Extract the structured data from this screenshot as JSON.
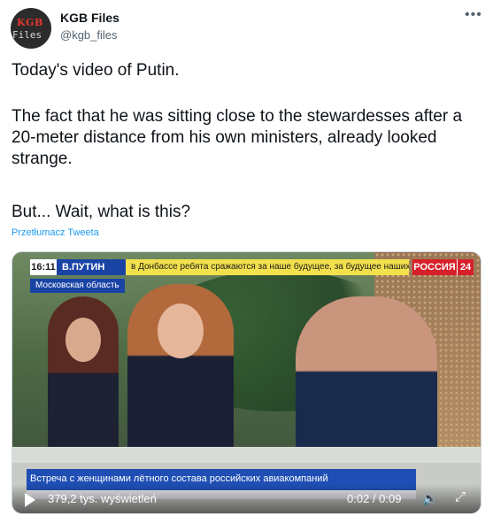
{
  "author": {
    "name": "KGB Files",
    "handle": "@kgb_files",
    "avatar_text_top": "KGB",
    "avatar_text_bottom": "Files"
  },
  "more_icon": "more-horizontal-icon",
  "tweet": {
    "line1": "Today's video of Putin.",
    "line2": "The fact that he was sitting close to the stewardesses after a 20-meter distance from his own ministers, already looked strange.",
    "line3": "But... Wait, what is this?",
    "translate": "Przetłumacz Tweeta"
  },
  "video": {
    "clock": "16:11",
    "name_badge": "В.ПУТИН",
    "ticker": "в Донбассе ребята сражаются за наше будущее, за будущее наших де",
    "region": "Московская область",
    "channel": "РОССИЯ",
    "channel_num": "24",
    "lower_third": "Встреча с женщинами лётного состава российских авиакомпаний",
    "views": "379,2 tys. wyświetleń",
    "time": "0:02 / 0:09"
  }
}
